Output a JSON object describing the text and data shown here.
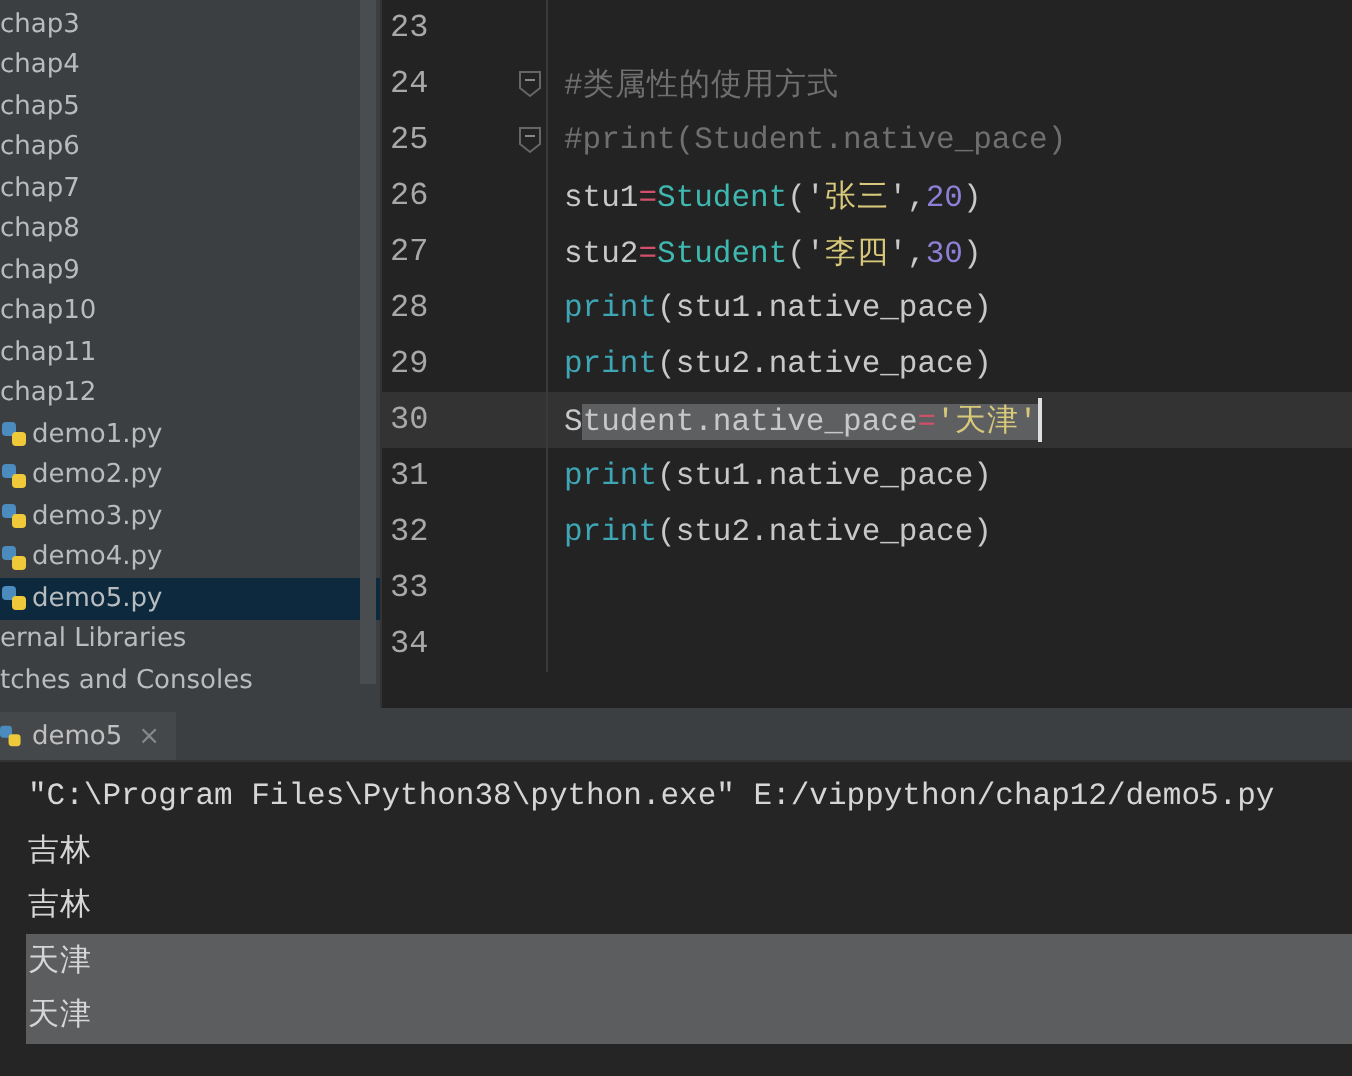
{
  "project_tree": {
    "items": [
      {
        "label": "chap3",
        "kind": "folder",
        "selected": false
      },
      {
        "label": "chap4",
        "kind": "folder",
        "selected": false
      },
      {
        "label": "chap5",
        "kind": "folder",
        "selected": false
      },
      {
        "label": "chap6",
        "kind": "folder",
        "selected": false
      },
      {
        "label": "chap7",
        "kind": "folder",
        "selected": false
      },
      {
        "label": "chap8",
        "kind": "folder",
        "selected": false
      },
      {
        "label": "chap9",
        "kind": "folder",
        "selected": false
      },
      {
        "label": "chap10",
        "kind": "folder",
        "selected": false
      },
      {
        "label": "chap11",
        "kind": "folder",
        "selected": false
      },
      {
        "label": "chap12",
        "kind": "folder",
        "selected": false
      },
      {
        "label": "demo1.py",
        "kind": "python_file",
        "selected": false
      },
      {
        "label": "demo2.py",
        "kind": "python_file",
        "selected": false
      },
      {
        "label": "demo3.py",
        "kind": "python_file",
        "selected": false
      },
      {
        "label": "demo4.py",
        "kind": "python_file",
        "selected": false
      },
      {
        "label": "demo5.py",
        "kind": "python_file",
        "selected": true
      },
      {
        "label": "ernal Libraries",
        "kind": "group",
        "selected": false
      },
      {
        "label": "tches and Consoles",
        "kind": "group",
        "selected": false
      }
    ]
  },
  "editor": {
    "lines": [
      {
        "number": "23",
        "fold": false,
        "current": false,
        "caret": false
      },
      {
        "number": "24",
        "fold": true,
        "current": false,
        "caret": false,
        "tokens": [
          {
            "text": "#类属性的使用方式",
            "kind": "comment",
            "selected": false
          }
        ]
      },
      {
        "number": "25",
        "fold": true,
        "current": false,
        "caret": false,
        "tokens": [
          {
            "text": "#print(Student.native_pace)",
            "kind": "comment",
            "selected": false
          }
        ]
      },
      {
        "number": "26",
        "fold": false,
        "current": false,
        "caret": false,
        "tokens": [
          {
            "text": "stu1",
            "kind": "name",
            "selected": false
          },
          {
            "text": "=",
            "kind": "operator",
            "selected": false
          },
          {
            "text": "Student",
            "kind": "class",
            "selected": false
          },
          {
            "text": "('",
            "kind": "name",
            "selected": false
          },
          {
            "text": "张三",
            "kind": "string",
            "selected": false
          },
          {
            "text": "',",
            "kind": "name",
            "selected": false
          },
          {
            "text": "20",
            "kind": "number",
            "selected": false
          },
          {
            "text": ")",
            "kind": "name",
            "selected": false
          }
        ]
      },
      {
        "number": "27",
        "fold": false,
        "current": false,
        "caret": false,
        "tokens": [
          {
            "text": "stu2",
            "kind": "name",
            "selected": false
          },
          {
            "text": "=",
            "kind": "operator",
            "selected": false
          },
          {
            "text": "Student",
            "kind": "class",
            "selected": false
          },
          {
            "text": "('",
            "kind": "name",
            "selected": false
          },
          {
            "text": "李四",
            "kind": "string",
            "selected": false
          },
          {
            "text": "',",
            "kind": "name",
            "selected": false
          },
          {
            "text": "30",
            "kind": "number",
            "selected": false
          },
          {
            "text": ")",
            "kind": "name",
            "selected": false
          }
        ]
      },
      {
        "number": "28",
        "fold": false,
        "current": false,
        "caret": false,
        "tokens": [
          {
            "text": "print",
            "kind": "builtin",
            "selected": false
          },
          {
            "text": "(stu1.native_pace)",
            "kind": "name",
            "selected": false
          }
        ]
      },
      {
        "number": "29",
        "fold": false,
        "current": false,
        "caret": false,
        "tokens": [
          {
            "text": "print",
            "kind": "builtin",
            "selected": false
          },
          {
            "text": "(stu2.native_pace)",
            "kind": "name",
            "selected": false
          }
        ]
      },
      {
        "number": "30",
        "fold": false,
        "current": true,
        "caret": true,
        "tokens": [
          {
            "text": "S",
            "kind": "name",
            "selected": false
          },
          {
            "text": "tudent.native_pace",
            "kind": "name",
            "selected": true
          },
          {
            "text": "=",
            "kind": "operator",
            "selected": true
          },
          {
            "text": "'天津'",
            "kind": "string",
            "selected": true
          }
        ]
      },
      {
        "number": "31",
        "fold": false,
        "current": false,
        "caret": false,
        "tokens": [
          {
            "text": "print",
            "kind": "builtin",
            "selected": false
          },
          {
            "text": "(stu1.native_pace)",
            "kind": "name",
            "selected": false
          }
        ]
      },
      {
        "number": "32",
        "fold": false,
        "current": false,
        "caret": false,
        "tokens": [
          {
            "text": "print",
            "kind": "builtin",
            "selected": false
          },
          {
            "text": "(stu2.native_pace)",
            "kind": "name",
            "selected": false
          }
        ]
      },
      {
        "number": "33",
        "fold": false,
        "current": false,
        "caret": false
      },
      {
        "number": "34",
        "fold": false,
        "current": false,
        "caret": false
      }
    ]
  },
  "run_panel": {
    "tab": {
      "label": "demo5",
      "close": "×"
    },
    "lines": [
      {
        "text": "\"C:\\Program Files\\Python38\\python.exe\" E:/vippython/chap12/demo5.py",
        "selected": false
      },
      {
        "text": "吉林",
        "selected": false
      },
      {
        "text": "吉林",
        "selected": false
      },
      {
        "text": "天津",
        "selected": true
      },
      {
        "text": "天津",
        "selected": true
      }
    ]
  }
}
